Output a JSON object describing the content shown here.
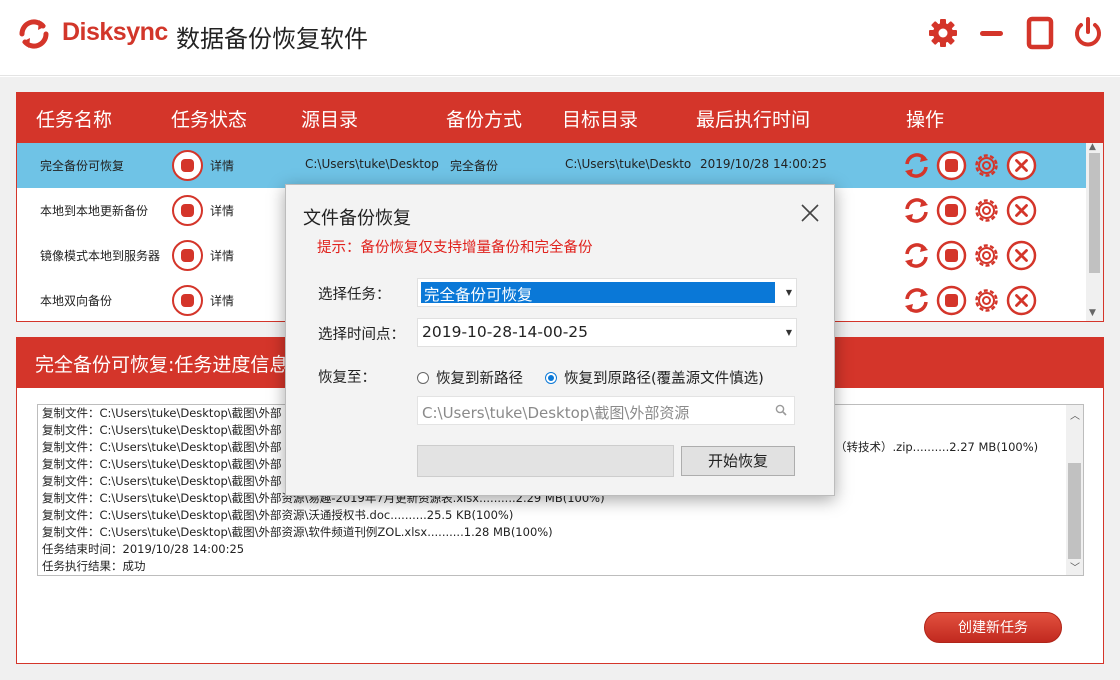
{
  "app": {
    "brand": "Disksync",
    "title": "数据备份恢复软件",
    "colors": {
      "accent": "#d4352a",
      "selected_row": "#6fc3e6",
      "selection_blue": "#0a78d7",
      "hint_red": "#e0221d"
    },
    "window_icons": [
      "gear-icon",
      "minimize-icon",
      "maximize-icon",
      "power-icon"
    ]
  },
  "tasks": {
    "columns": [
      "任务名称",
      "任务状态",
      "源目录",
      "备份方式",
      "目标目录",
      "最后执行时间",
      "操作"
    ],
    "detail_label": "详情",
    "rows": [
      {
        "name": "完全备份可恢复",
        "source": "C:\\Users\\tuke\\Desktop",
        "mode": "完全备份",
        "target": "C:\\Users\\tuke\\Deskto",
        "last_run": "2019/10/28 14:00:25",
        "selected": true
      },
      {
        "name": "本地到本地更新备份",
        "source": "",
        "mode": "",
        "target": "",
        "last_run": "",
        "selected": false
      },
      {
        "name": "镜像模式本地到服务器",
        "source": "",
        "mode": "",
        "target": "",
        "last_run": "",
        "selected": false
      },
      {
        "name": "本地双向备份",
        "source": "",
        "mode": "",
        "target": "",
        "last_run": "",
        "selected": false
      }
    ],
    "op_icons": [
      "refresh-icon",
      "stop-icon",
      "settings-icon",
      "delete-icon"
    ]
  },
  "progress": {
    "title": "完全备份可恢复:任务进度信息",
    "log": [
      "复制文件：C:\\Users\\tuke\\Desktop\\截图\\外部",
      "复制文件：C:\\Users\\tuke\\Desktop\\截图\\外部",
      "复制文件：C:\\Users\\tuke\\Desktop\\截图\\外部",
      "复制文件：C:\\Users\\tuke\\Desktop\\截图\\外部",
      "复制文件：C:\\Users\\tuke\\Desktop\\截图\\外部",
      "复制文件：C:\\Users\\tuke\\Desktop\\截图\\外部资源\\易趣-2019年7月更新资源表.xlsx..........2.29 MB(100%)",
      "复制文件：C:\\Users\\tuke\\Desktop\\截图\\外部资源\\沃通授权书.doc..........25.5 KB(100%)",
      "复制文件：C:\\Users\\tuke\\Desktop\\截图\\外部资源\\软件频道刊例ZOL.xlsx..........1.28 MB(100%)",
      "任务结束时间：2019/10/28 14:00:25",
      "任务执行结果：成功"
    ],
    "log_tail_fragment": "（转技术）.zip..........2.27 MB(100%)",
    "create_button": "创建新任务"
  },
  "dialog": {
    "title": "文件备份恢复",
    "hint": "提示：备份恢复仅支持增量备份和完全备份",
    "task_label": "选择任务：",
    "task_value": "完全备份可恢复",
    "time_label": "选择时间点：",
    "time_value": "2019-10-28-14-00-25",
    "restore_label": "恢复至：",
    "radio_new": "恢复到新路径",
    "radio_original": "恢复到原路径(覆盖源文件慎选)",
    "radio_selected": "original",
    "path_value": "C:\\Users\\tuke\\Desktop\\截图\\外部资源",
    "start_button": "开始恢复"
  }
}
